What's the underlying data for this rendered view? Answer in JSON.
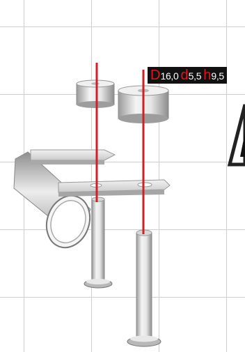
{
  "dimension_label": {
    "d_outer_key": "D",
    "d_outer_value": "16,0",
    "d_inner_key": "d",
    "d_inner_value": "5,5",
    "height_key": "h",
    "height_value": "9,5"
  },
  "colors": {
    "axis_line": "#d51e24",
    "label_background": "#111111",
    "label_key": "#e0141e",
    "label_value": "#ffffff",
    "grid": "#cfcfcf"
  }
}
